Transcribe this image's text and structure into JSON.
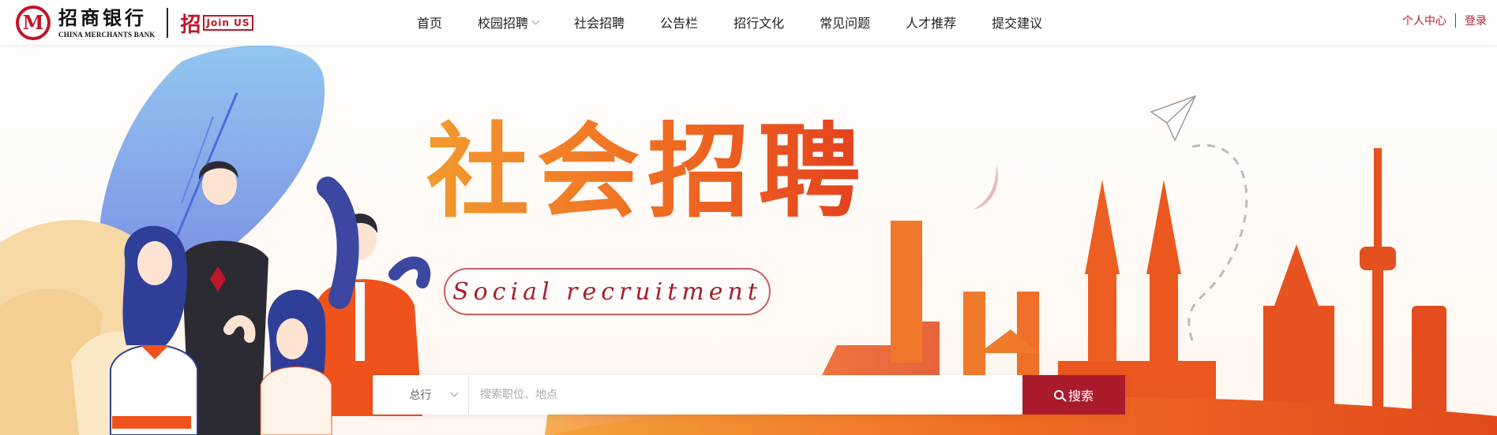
{
  "brand": {
    "logo_mark": "M",
    "name_cn": "招商银行",
    "name_en": "CHINA MERCHANTS BANK",
    "join_cn": "招",
    "join_tag": "Join US"
  },
  "nav": {
    "items": [
      {
        "label": "首页",
        "has_dropdown": false
      },
      {
        "label": "校园招聘",
        "has_dropdown": true
      },
      {
        "label": "社会招聘",
        "has_dropdown": false
      },
      {
        "label": "公告栏",
        "has_dropdown": false
      },
      {
        "label": "招行文化",
        "has_dropdown": false
      },
      {
        "label": "常见问题",
        "has_dropdown": false
      },
      {
        "label": "人才推荐",
        "has_dropdown": false
      },
      {
        "label": "提交建议",
        "has_dropdown": false
      }
    ]
  },
  "user": {
    "center_label": "个人中心",
    "login_label": "登录"
  },
  "banner": {
    "title": "社会招聘",
    "subtitle": "Social recruitment"
  },
  "search": {
    "scope_value": "总行",
    "placeholder": "搜索职位、地点",
    "button_label": "搜索"
  },
  "colors": {
    "brand_red": "#ab1a2a",
    "accent_orange": "#f06a22"
  }
}
